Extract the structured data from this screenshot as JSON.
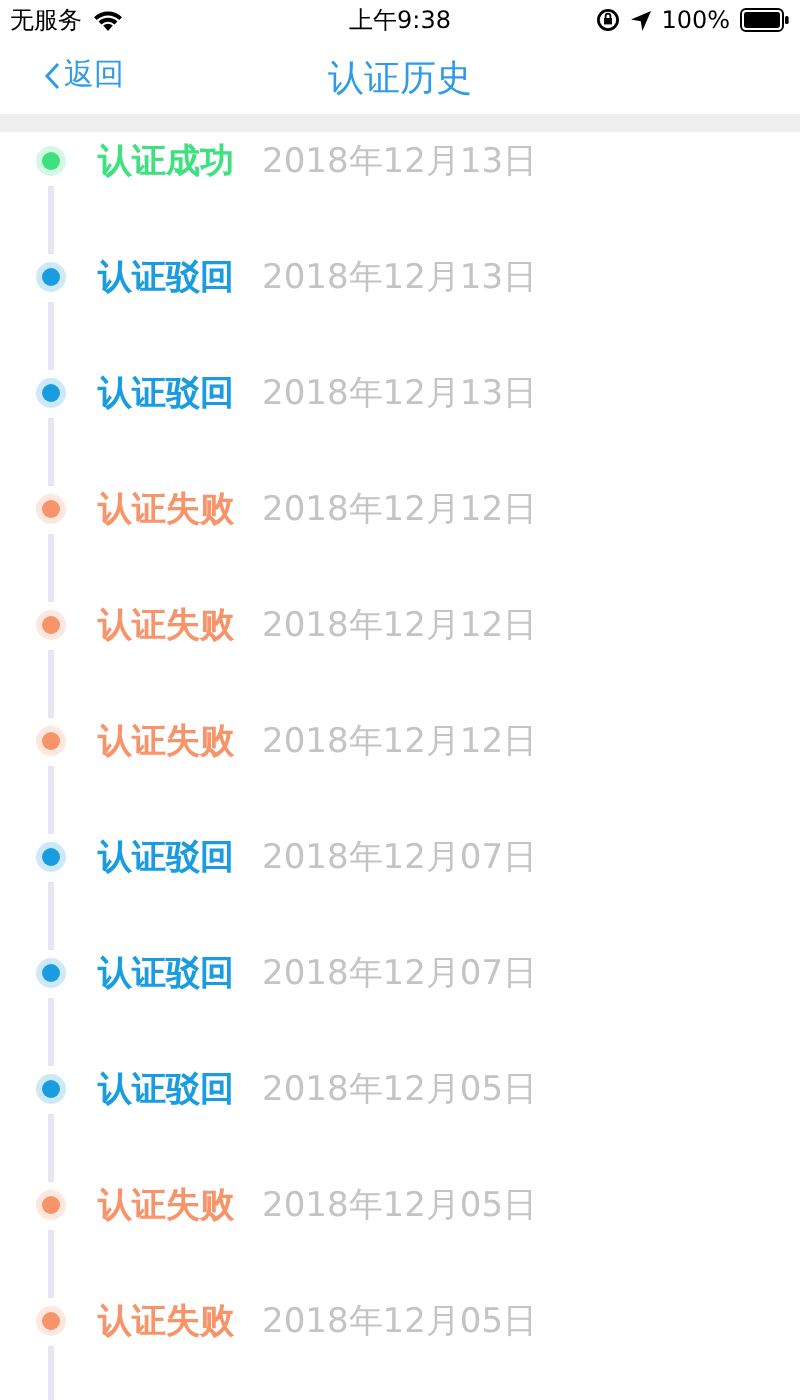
{
  "status_bar": {
    "carrier": "无服务",
    "time": "上午9:38",
    "battery": "100%"
  },
  "nav": {
    "back": "返回",
    "title": "认证历史"
  },
  "records": [
    {
      "status": "认证成功",
      "date": "2018年12月13日",
      "color": "#3ee07f"
    },
    {
      "status": "认证驳回",
      "date": "2018年12月13日",
      "color": "#1a9de0"
    },
    {
      "status": "认证驳回",
      "date": "2018年12月13日",
      "color": "#1a9de0"
    },
    {
      "status": "认证失败",
      "date": "2018年12月12日",
      "color": "#f7946a"
    },
    {
      "status": "认证失败",
      "date": "2018年12月12日",
      "color": "#f7946a"
    },
    {
      "status": "认证失败",
      "date": "2018年12月12日",
      "color": "#f7946a"
    },
    {
      "status": "认证驳回",
      "date": "2018年12月07日",
      "color": "#1a9de0"
    },
    {
      "status": "认证驳回",
      "date": "2018年12月07日",
      "color": "#1a9de0"
    },
    {
      "status": "认证驳回",
      "date": "2018年12月05日",
      "color": "#1a9de0"
    },
    {
      "status": "认证失败",
      "date": "2018年12月05日",
      "color": "#f7946a"
    },
    {
      "status": "认证失败",
      "date": "2018年12月05日",
      "color": "#f7946a"
    }
  ]
}
